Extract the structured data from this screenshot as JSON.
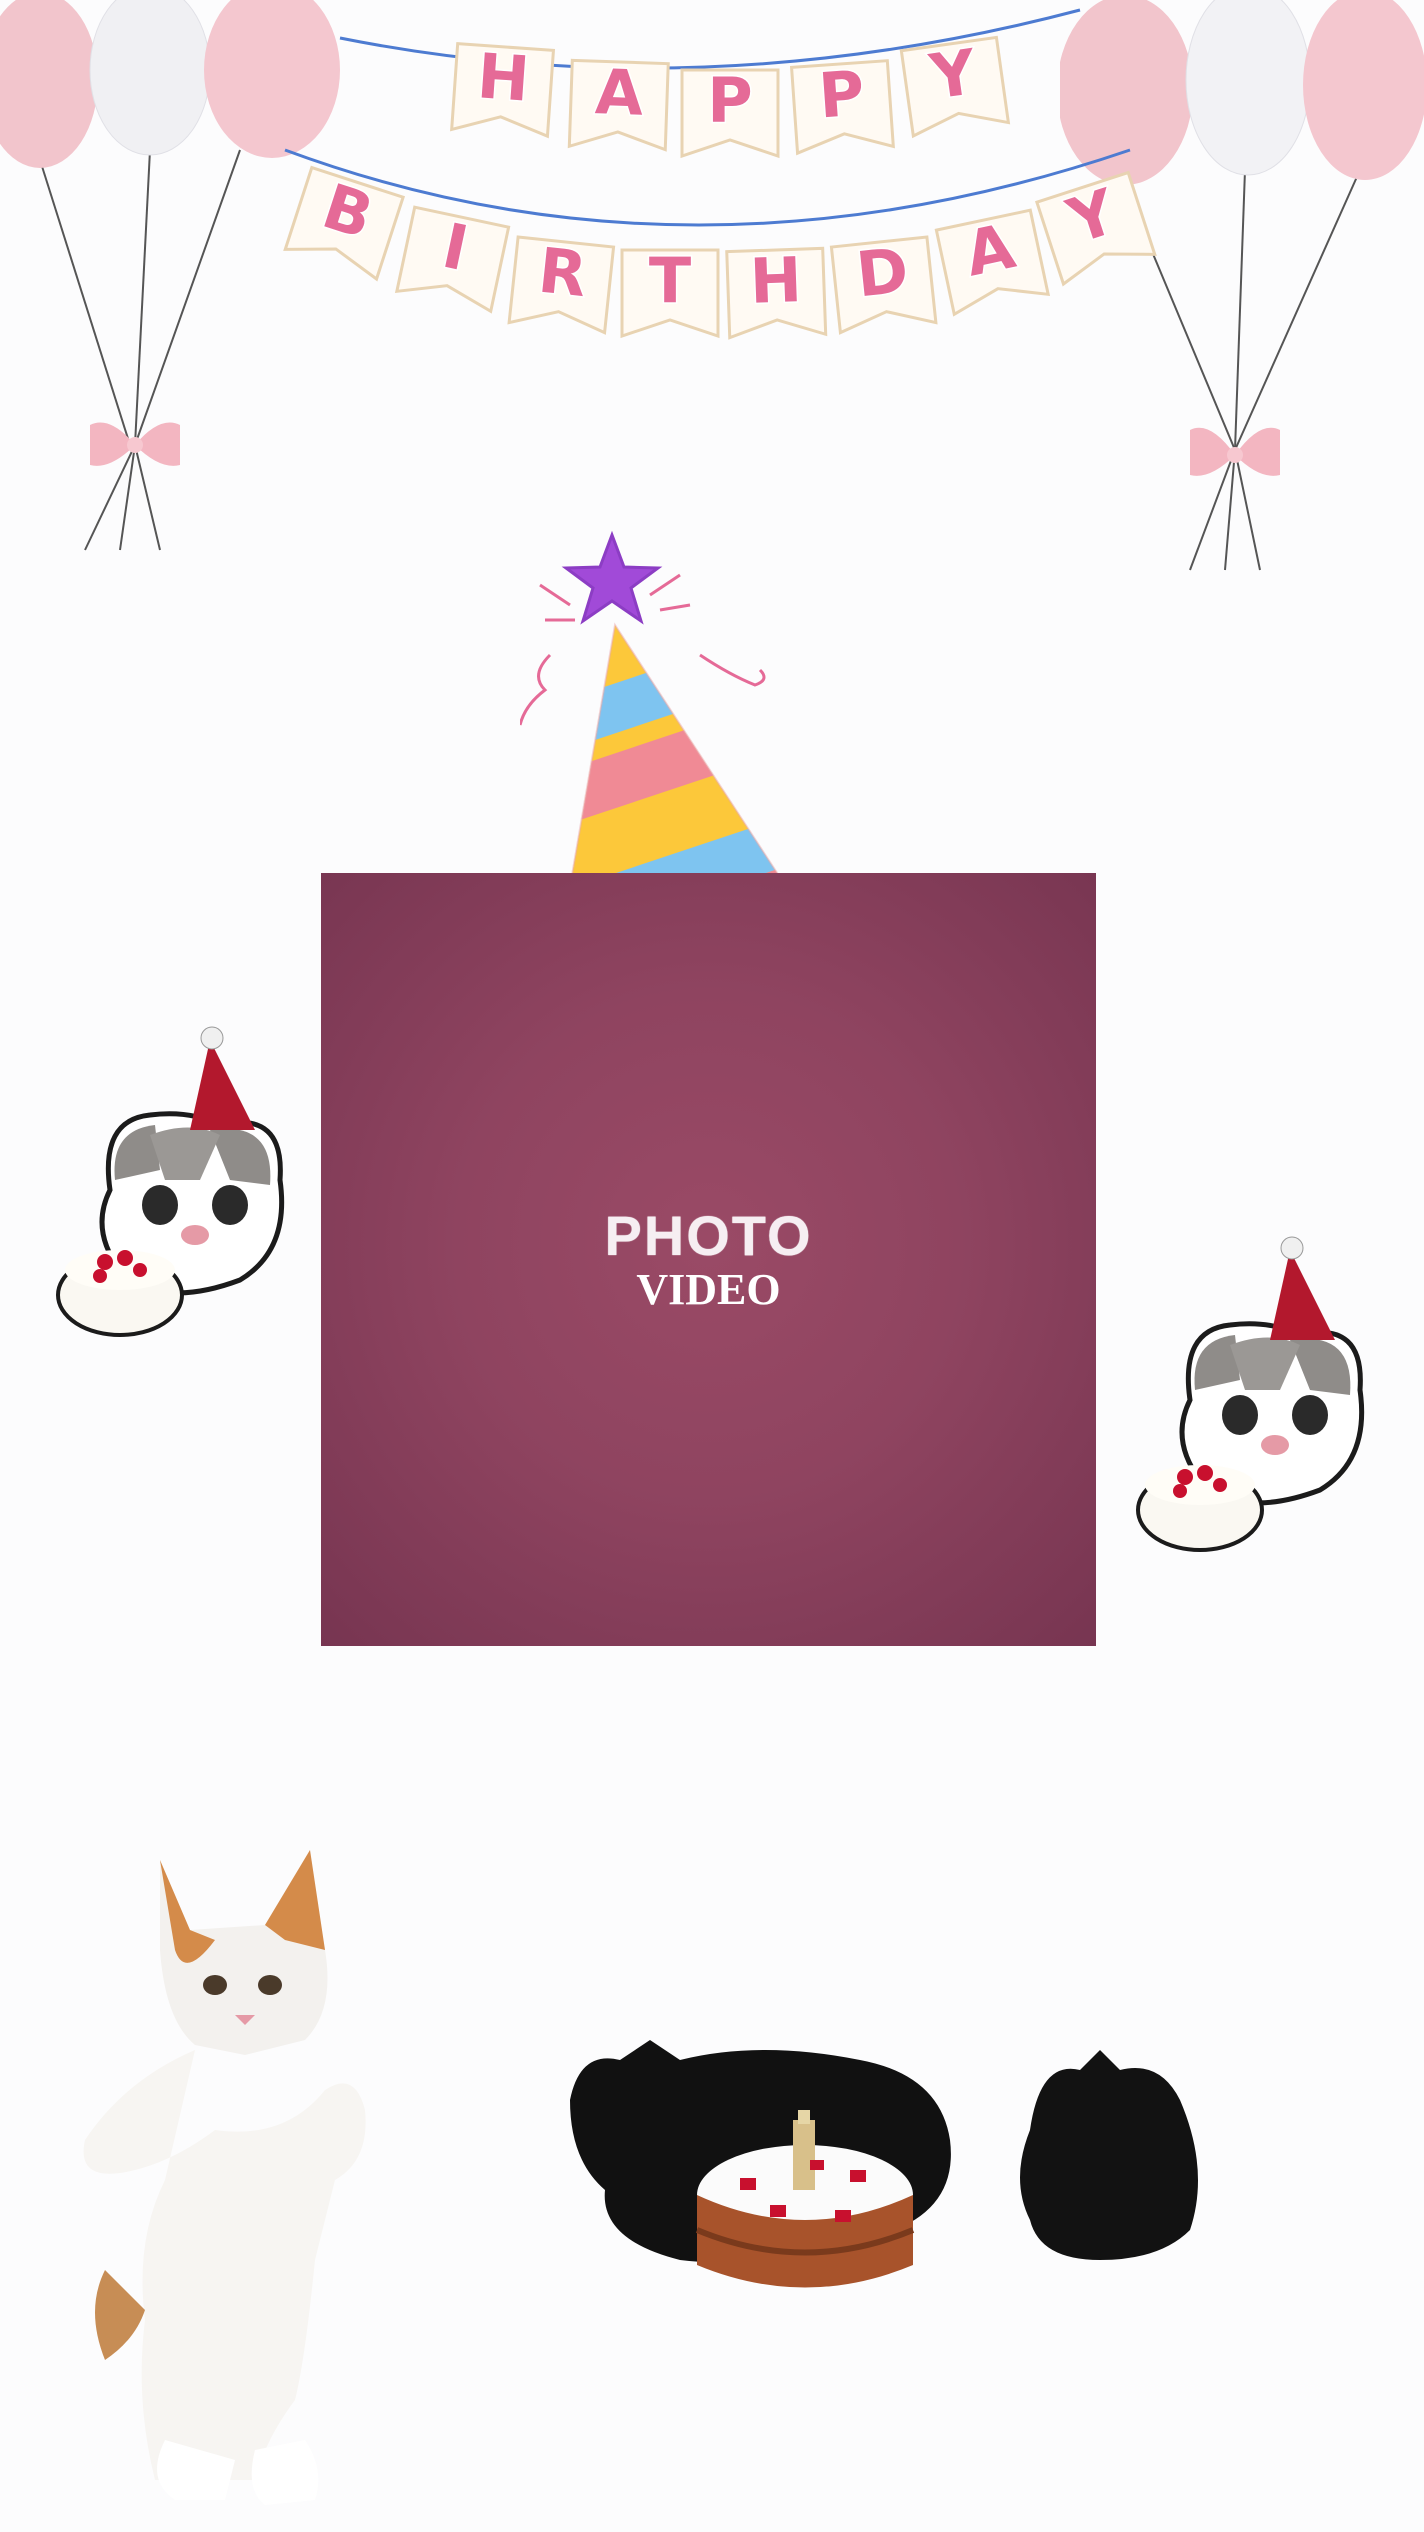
{
  "banner": {
    "row1_letters": [
      "H",
      "A",
      "P",
      "P",
      "Y"
    ],
    "row2_letters": [
      "B",
      "I",
      "R",
      "T",
      "H",
      "D",
      "A",
      "Y"
    ],
    "letter_color": "#e56a97",
    "flag_color": "#fffaf3",
    "string_color": "#4d7bd1"
  },
  "frame": {
    "placeholder_title": "PHOTO",
    "placeholder_subtitle": "VIDEO",
    "background_color": "#8f4460"
  },
  "colors": {
    "balloon_pink": "#f2c5cc",
    "balloon_white": "#f4f4f6",
    "hat_yellow": "#fcc83a",
    "hat_blue": "#7ec4f0",
    "hat_pink": "#f08a95",
    "hat_star": "#a14ad8"
  },
  "stickers": [
    "balloon-cluster-left",
    "balloon-cluster-right",
    "party-hat",
    "cat-with-cake-left",
    "cat-with-cake-right",
    "dancing-cat",
    "black-cats-with-cake"
  ]
}
